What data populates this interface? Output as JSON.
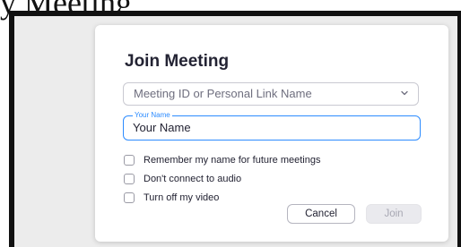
{
  "caption": "y Meeting",
  "dialog": {
    "title": "Join Meeting",
    "meeting_id": {
      "placeholder": "Meeting ID or Personal Link Name",
      "icon": "chevron-down-icon"
    },
    "name_field": {
      "label": "Your Name",
      "value": "Your Name"
    },
    "options": [
      {
        "label": "Remember my name for future meetings",
        "checked": false
      },
      {
        "label": "Don't connect to audio",
        "checked": false
      },
      {
        "label": "Turn off my video",
        "checked": false
      }
    ],
    "buttons": {
      "cancel": "Cancel",
      "join": "Join"
    }
  },
  "colors": {
    "accent": "#2d8cff",
    "text": "#232333",
    "disabled_text": "#a8a8b3",
    "backdrop": "#ececec"
  }
}
